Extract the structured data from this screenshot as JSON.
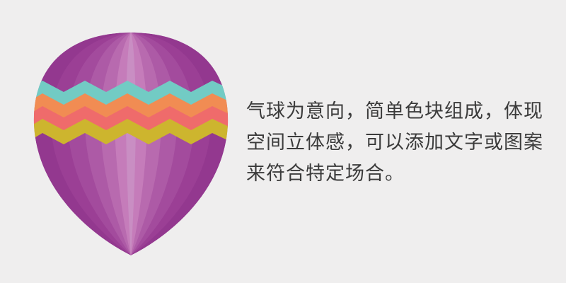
{
  "caption": {
    "lines": [
      "气球为意向，简单色块组成，体现",
      "空间立体感，可以添加文字或图案",
      "来符合特定场合。"
    ]
  },
  "illustration": {
    "name": "hot-air-balloon",
    "colors": {
      "background": "#efeeee",
      "outer_stripe": "#93388f",
      "stripes": [
        "#9b3f95",
        "#a34b9d",
        "#ad5aa6",
        "#b86aaf",
        "#c57cba",
        "#c98ec3"
      ],
      "band_teal": "#72cbc4",
      "band_orange": "#f18c53",
      "band_coral": "#ef6b6b",
      "band_gold": "#cdb52e"
    }
  }
}
